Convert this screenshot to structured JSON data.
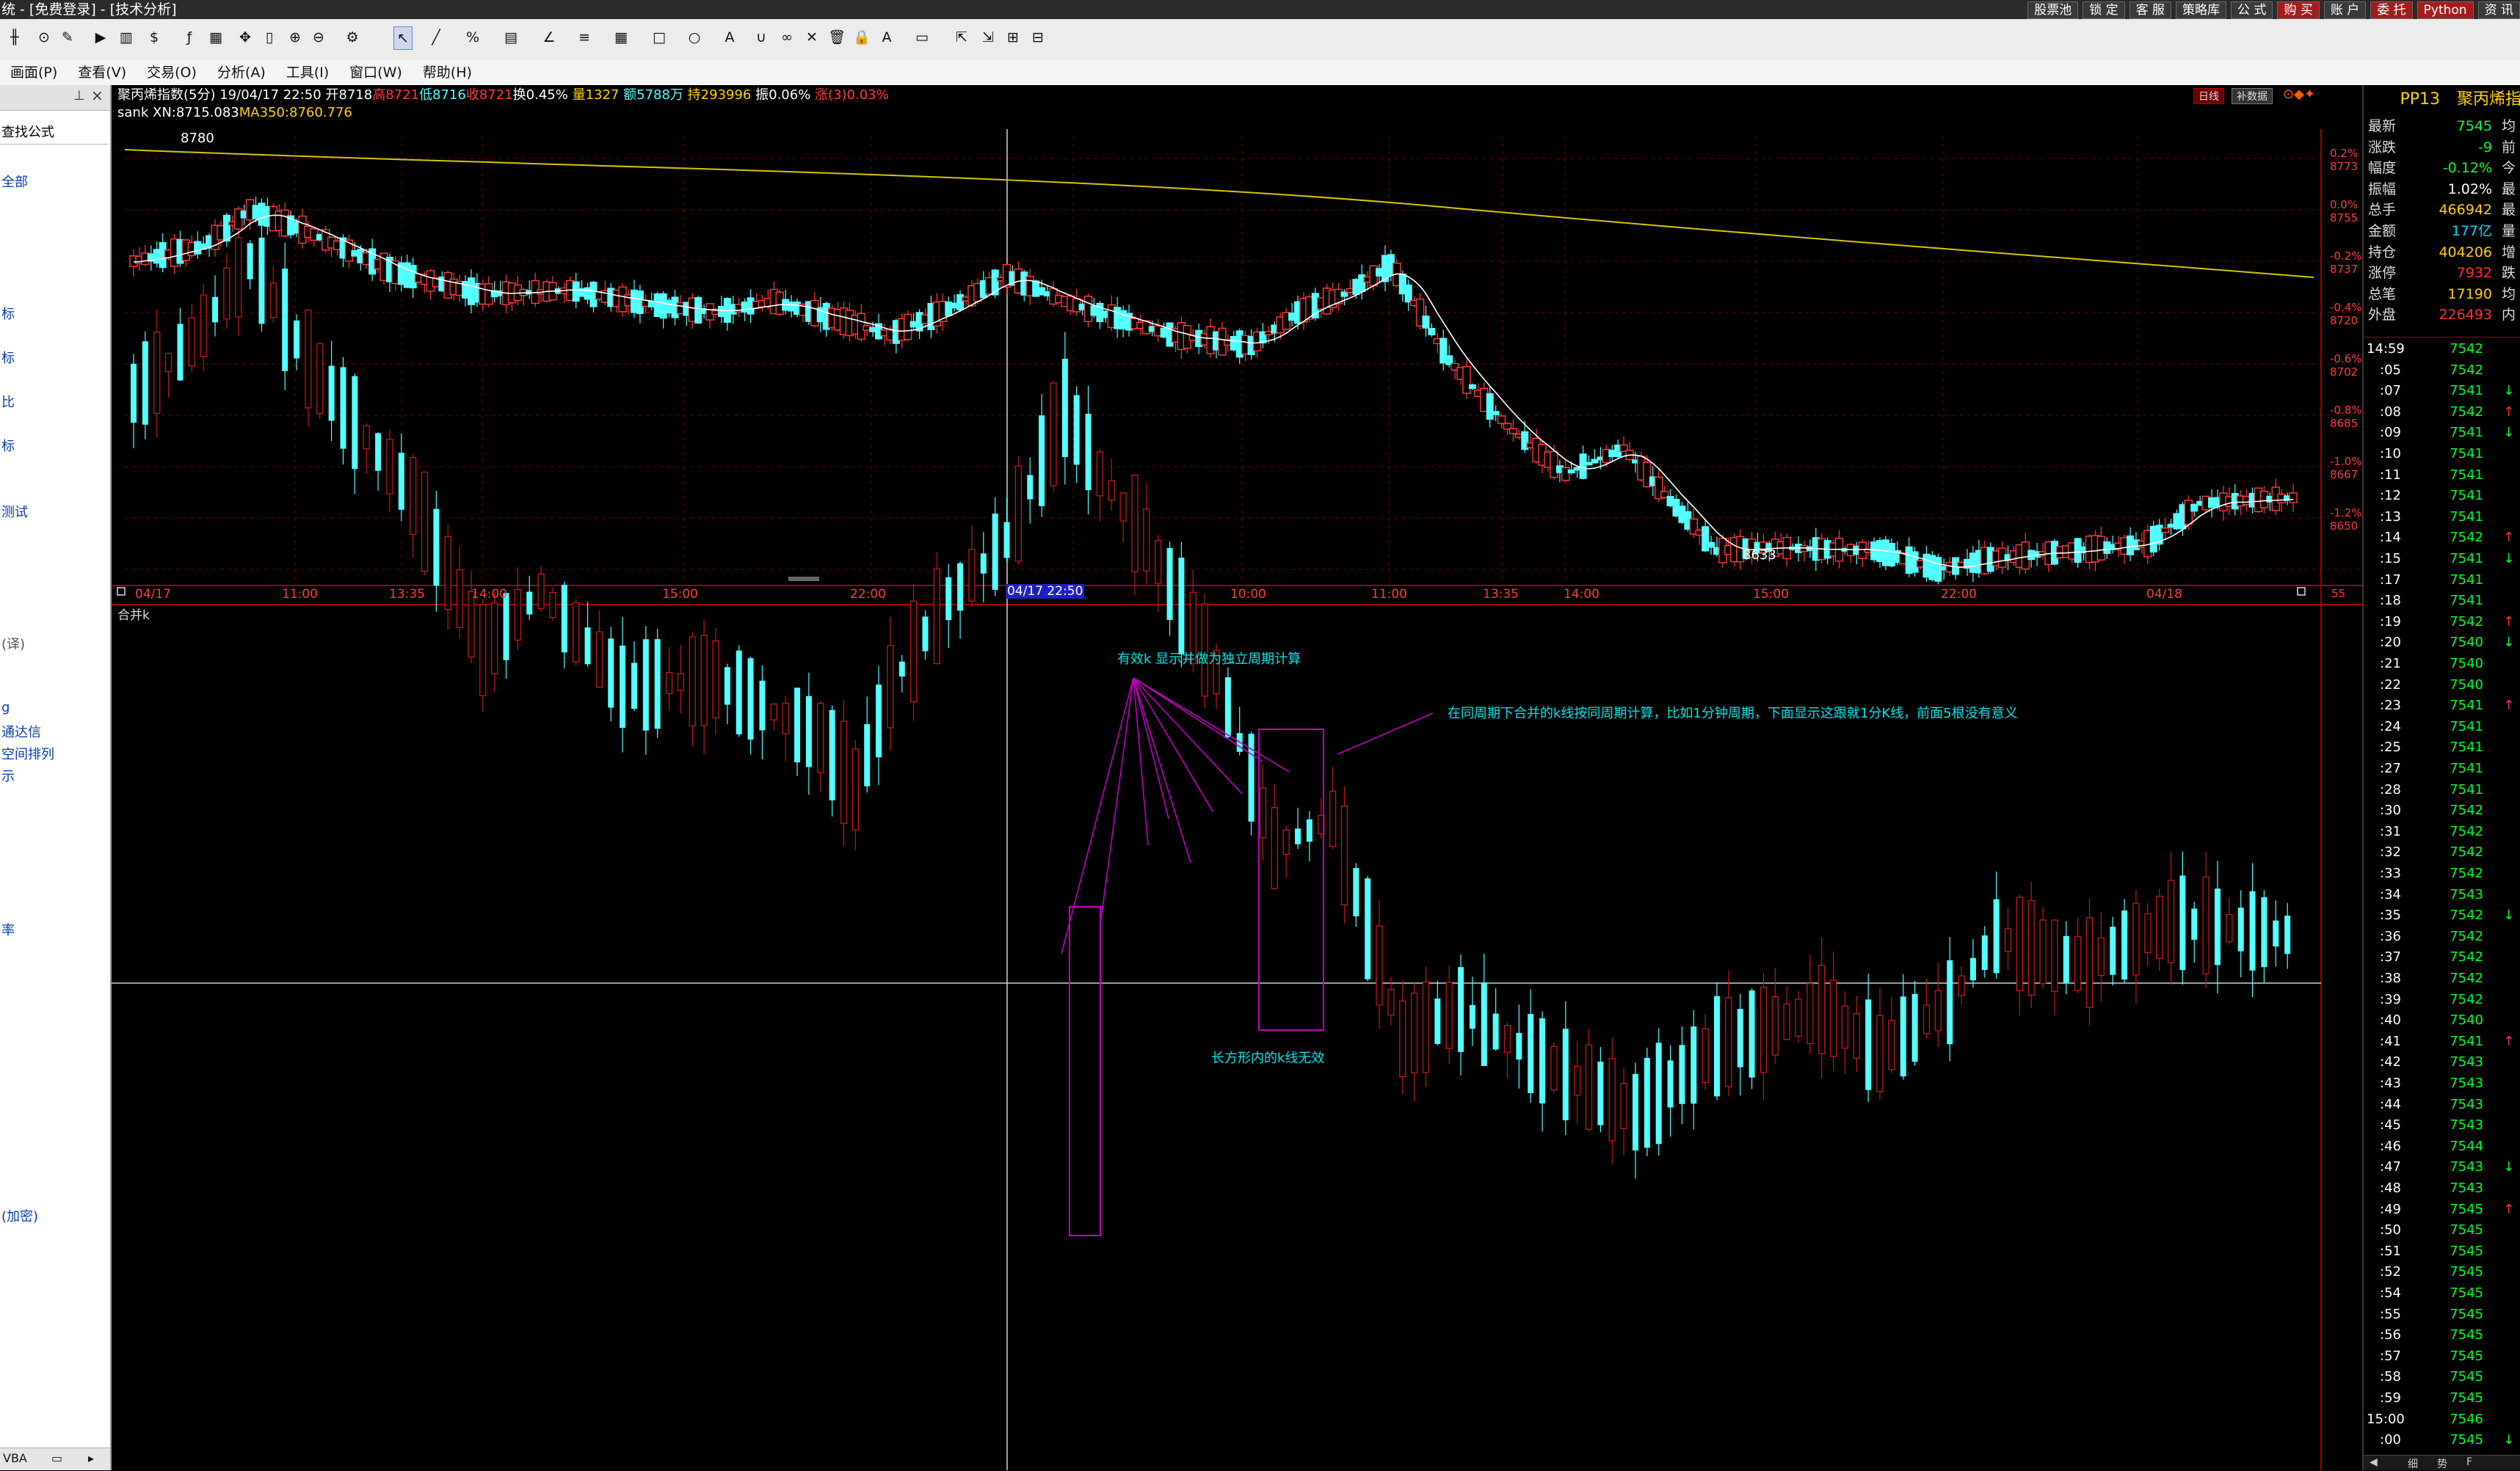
{
  "window": {
    "title": "统 - [免费登录] - [技术分析]",
    "top_buttons": [
      "股票池",
      "锁 定",
      "客 服",
      "策略库",
      "公 式",
      "购 买",
      "账 户",
      "委 托",
      "Python",
      "资 讯"
    ]
  },
  "menu": [
    "画面(P)",
    "查看(V)",
    "交易(O)",
    "分析(A)",
    "工具(I)",
    "窗口(W)",
    "帮助(H)"
  ],
  "left_panel": {
    "pin_icon": "pin-icon",
    "close_icon": "close-icon",
    "search_label": "查找公式",
    "items": [
      "全部",
      "标",
      "标",
      "比",
      "标",
      "测试",
      "(译)",
      "g",
      "通达信",
      "空间排列",
      "示",
      "率",
      "(加密)"
    ],
    "bottom": "VBA"
  },
  "main_chart": {
    "header": {
      "name": "聚丙烯指数(5分)",
      "datetime": "19/04/17 22:50",
      "open": "开8718",
      "high": "高8721",
      "low": "低8716",
      "close": "收8721",
      "turnover": "换0.45%",
      "volume": "量1327",
      "amount": "额5788万",
      "position": "持293996",
      "amplitude": "振0.06%",
      "change": "涨(3)0.03%"
    },
    "indicator_line": {
      "name": "sank",
      "xn": "XN:8715.083",
      "ma": "MA350:8760.776"
    },
    "right_labels": [
      "0.2%",
      "0.0%",
      "-0.2%",
      "-0.4%",
      "-0.6%",
      "-0.8%",
      "-1.0%",
      "-1.2%"
    ],
    "right_prices": [
      "8773",
      "8755",
      "8737",
      "8720",
      "8702",
      "8685",
      "8667",
      "8650"
    ],
    "high_label": "8780",
    "low_label": "8633",
    "x_axis": [
      "04/17",
      "11:00",
      "13:35",
      "14:00",
      "15:00",
      "22:00",
      "04/17 22:50",
      "10:00",
      "11:00",
      "13:35",
      "14:00",
      "15:00",
      "22:00",
      "04/18"
    ],
    "top_right_tags": [
      "日线",
      "补数据"
    ],
    "bottom_right": "55"
  },
  "sub_chart": {
    "title": "合并k",
    "annotations": [
      "有效k 显示并做为独立周期计算",
      "在同周期下合并的k线按同周期计算，比如1分钟周期，下面显示这跟就1分K线，前面5根没有意义",
      "长方形内的k线无效"
    ]
  },
  "quote_panel": {
    "symbol": "PP13",
    "name": "聚丙烯指",
    "fields": [
      {
        "label": "最新",
        "value": "7545",
        "extra": "均"
      },
      {
        "label": "涨跌",
        "value": "-9",
        "extra": "前"
      },
      {
        "label": "幅度",
        "value": "-0.12%",
        "extra": "今"
      },
      {
        "label": "振幅",
        "value": "1.02%",
        "extra": "最"
      },
      {
        "label": "总手",
        "value": "466942",
        "extra": "最"
      },
      {
        "label": "金额",
        "value": "177亿",
        "extra": "量"
      },
      {
        "label": "持仓",
        "value": "404206",
        "extra": "增"
      },
      {
        "label": "涨停",
        "value": "7932",
        "extra": "跌"
      },
      {
        "label": "总笔",
        "value": "17190",
        "extra": "均"
      },
      {
        "label": "外盘",
        "value": "226493",
        "extra": "内"
      }
    ],
    "ticks": [
      {
        "time": "14:59",
        "price": "7542",
        "arrow": ""
      },
      {
        "time": ":05",
        "price": "7542",
        "arrow": ""
      },
      {
        "time": ":07",
        "price": "7541",
        "arrow": "↓"
      },
      {
        "time": ":08",
        "price": "7542",
        "arrow": "↑"
      },
      {
        "time": ":09",
        "price": "7541",
        "arrow": "↓"
      },
      {
        "time": ":10",
        "price": "7541",
        "arrow": ""
      },
      {
        "time": ":11",
        "price": "7541",
        "arrow": ""
      },
      {
        "time": ":12",
        "price": "7541",
        "arrow": ""
      },
      {
        "time": ":13",
        "price": "7541",
        "arrow": ""
      },
      {
        "time": ":14",
        "price": "7542",
        "arrow": "↑"
      },
      {
        "time": ":15",
        "price": "7541",
        "arrow": "↓"
      },
      {
        "time": ":17",
        "price": "7541",
        "arrow": ""
      },
      {
        "time": ":18",
        "price": "7541",
        "arrow": ""
      },
      {
        "time": ":19",
        "price": "7542",
        "arrow": "↑"
      },
      {
        "time": ":20",
        "price": "7540",
        "arrow": "↓"
      },
      {
        "time": ":21",
        "price": "7540",
        "arrow": ""
      },
      {
        "time": ":22",
        "price": "7540",
        "arrow": ""
      },
      {
        "time": ":23",
        "price": "7541",
        "arrow": "↑"
      },
      {
        "time": ":24",
        "price": "7541",
        "arrow": ""
      },
      {
        "time": ":25",
        "price": "7541",
        "arrow": ""
      },
      {
        "time": ":27",
        "price": "7541",
        "arrow": ""
      },
      {
        "time": ":28",
        "price": "7541",
        "arrow": ""
      },
      {
        "time": ":30",
        "price": "7542",
        "arrow": ""
      },
      {
        "time": ":31",
        "price": "7542",
        "arrow": ""
      },
      {
        "time": ":32",
        "price": "7542",
        "arrow": ""
      },
      {
        "time": ":33",
        "price": "7542",
        "arrow": ""
      },
      {
        "time": ":34",
        "price": "7543",
        "arrow": ""
      },
      {
        "time": ":35",
        "price": "7542",
        "arrow": "↓"
      },
      {
        "time": ":36",
        "price": "7542",
        "arrow": ""
      },
      {
        "time": ":37",
        "price": "7542",
        "arrow": ""
      },
      {
        "time": ":38",
        "price": "7542",
        "arrow": ""
      },
      {
        "time": ":39",
        "price": "7542",
        "arrow": ""
      },
      {
        "time": ":40",
        "price": "7540",
        "arrow": ""
      },
      {
        "time": ":41",
        "price": "7541",
        "arrow": "↑"
      },
      {
        "time": ":42",
        "price": "7543",
        "arrow": ""
      },
      {
        "time": ":43",
        "price": "7543",
        "arrow": ""
      },
      {
        "time": ":44",
        "price": "7543",
        "arrow": ""
      },
      {
        "time": ":45",
        "price": "7543",
        "arrow": ""
      },
      {
        "time": ":46",
        "price": "7544",
        "arrow": ""
      },
      {
        "time": ":47",
        "price": "7543",
        "arrow": "↓"
      },
      {
        "time": ":48",
        "price": "7543",
        "arrow": ""
      },
      {
        "time": ":49",
        "price": "7545",
        "arrow": "↑"
      },
      {
        "time": ":50",
        "price": "7545",
        "arrow": ""
      },
      {
        "time": ":51",
        "price": "7545",
        "arrow": ""
      },
      {
        "time": ":52",
        "price": "7545",
        "arrow": ""
      },
      {
        "time": ":54",
        "price": "7545",
        "arrow": ""
      },
      {
        "time": ":55",
        "price": "7545",
        "arrow": ""
      },
      {
        "time": ":56",
        "price": "7545",
        "arrow": ""
      },
      {
        "time": ":57",
        "price": "7545",
        "arrow": ""
      },
      {
        "time": ":58",
        "price": "7545",
        "arrow": ""
      },
      {
        "time": ":59",
        "price": "7545",
        "arrow": ""
      },
      {
        "time": "15:00",
        "price": "7546",
        "arrow": ""
      },
      {
        "time": ":00",
        "price": "7545",
        "arrow": "↓"
      }
    ],
    "bottom_tabs": [
      "细",
      "势",
      "F"
    ]
  },
  "colors": {
    "up": "#ff3b3b",
    "up_fill": "#000000",
    "down": "#54ffff",
    "ma_yellow": "#d6c500",
    "xn_white": "#ffffff",
    "grid": "#7a0000",
    "annotation_cyan": "#00e5e5",
    "annotation_magenta": "#c000c0",
    "quote_green": "#00ff2a",
    "quote_red": "#ff3030",
    "quote_yellow": "#ffd100",
    "quote_cyan": "#00d8ff"
  }
}
